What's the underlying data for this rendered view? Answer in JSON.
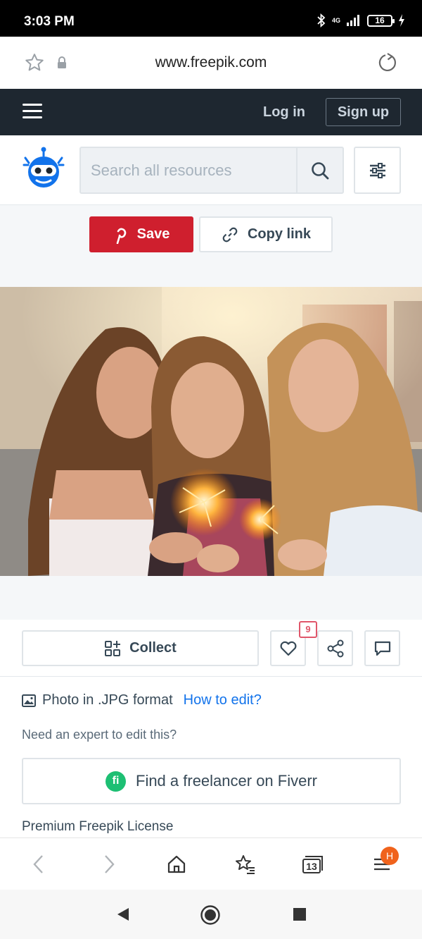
{
  "status_bar": {
    "time": "3:03 PM",
    "network": "4G",
    "battery": "16"
  },
  "address_bar": {
    "url": "www.freepik.com"
  },
  "header": {
    "login_label": "Log in",
    "signup_label": "Sign up"
  },
  "search": {
    "placeholder": "Search all resources"
  },
  "share": {
    "save_label": "Save",
    "copy_link_label": "Copy link"
  },
  "actions": {
    "collect_label": "Collect",
    "like_count": "9"
  },
  "details": {
    "format_text": "Photo in .JPG format",
    "how_to_edit": "How to edit?",
    "expert_prompt": "Need an expert to edit this?",
    "fiverr_label": "Find a freelancer on Fiverr",
    "fiverr_logo": "fi",
    "license_title": "Premium Freepik License"
  },
  "browser_toolbar": {
    "tabs_count": "13",
    "menu_badge": "H"
  },
  "colors": {
    "header_bg": "#1e2730",
    "save_red": "#cf1f2e",
    "link_blue": "#1273eb",
    "fiverr_green": "#1dbf73",
    "badge_orange": "#f0631c"
  }
}
